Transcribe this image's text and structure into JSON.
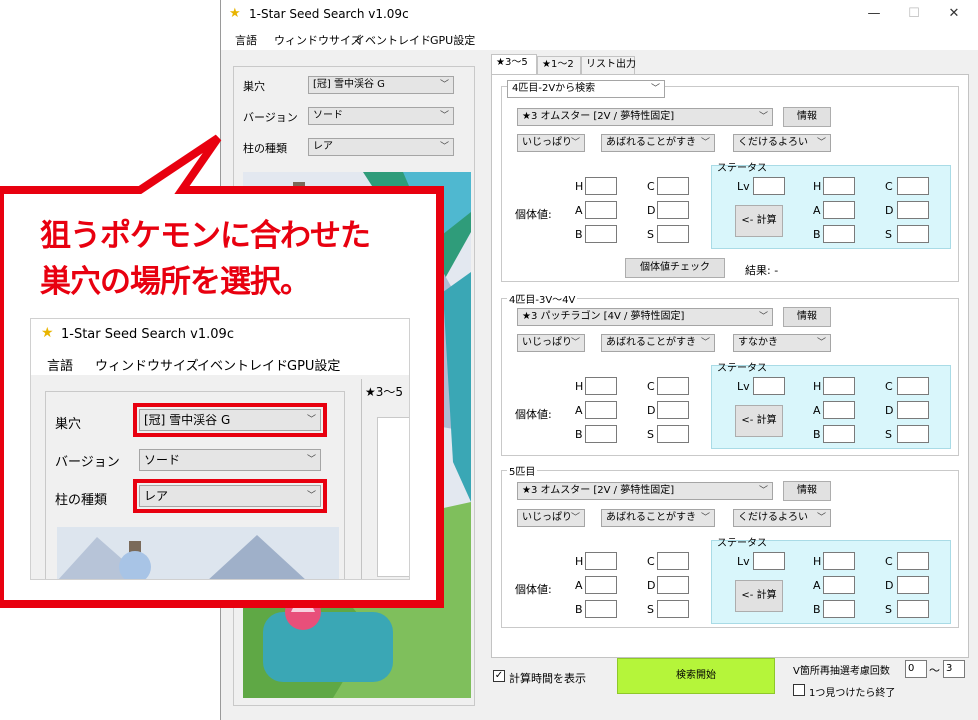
{
  "app": {
    "title": "1-Star Seed Search v1.09c",
    "minimize": "—",
    "maximize": "☐",
    "close": "✕"
  },
  "menu": [
    "言語",
    "ウィンドウサイズ",
    "イベントレイド",
    "GPU設定"
  ],
  "left": {
    "den_label": "巣穴",
    "den_value": "[冠] 雪中渓谷 G",
    "version_label": "バージョン",
    "version_value": "ソード",
    "pillar_label": "柱の種類",
    "pillar_value": "レア"
  },
  "tabs": [
    "★3～5",
    "★1～2",
    "リスト出力"
  ],
  "sections": [
    {
      "search_mode": "4匹目-2Vから検索",
      "pokemon": "★3 オムスター [2V / 夢特性固定]",
      "info": "情報",
      "nature": "いじっぱり",
      "characteristic": "あばれることがすき",
      "ability": "くだけるよろい",
      "ivs_label": "個体値:",
      "stats_label": "ステータス",
      "lv": "Lv",
      "calc": "<- 計算",
      "check": "個体値チェック",
      "result": "結果: -"
    },
    {
      "title": "4匹目-3V～4V",
      "pokemon": "★3 パッチラゴン [4V / 夢特性固定]",
      "info": "情報",
      "nature": "いじっぱり",
      "characteristic": "あばれることがすき",
      "ability": "すなかき",
      "ivs_label": "個体値:",
      "stats_label": "ステータス",
      "lv": "Lv",
      "calc": "<- 計算"
    },
    {
      "title": "5匹目",
      "pokemon": "★3 オムスター [2V / 夢特性固定]",
      "info": "情報",
      "nature": "いじっぱり",
      "characteristic": "あばれることがすき",
      "ability": "くだけるよろい",
      "ivs_label": "個体値:",
      "stats_label": "ステータス",
      "lv": "Lv",
      "calc": "<- 計算"
    }
  ],
  "stat_letters": [
    "H",
    "A",
    "B",
    "C",
    "D",
    "S"
  ],
  "bottom": {
    "show_time": "計算時間を表示",
    "start": "検索開始",
    "reroll_label": "V箇所再抽選考慮回数",
    "reroll_from": "0",
    "tilde": "～",
    "reroll_to": "3",
    "stop_label": "1つ見つけたら終了"
  },
  "callout": {
    "line1": "狙うポケモンに合わせた",
    "line2": "巣穴の場所を選択。"
  },
  "colors": {
    "accent_red": "#e8000f",
    "start_green": "#b5f53a",
    "stat_panel": "#d9f6fb"
  }
}
